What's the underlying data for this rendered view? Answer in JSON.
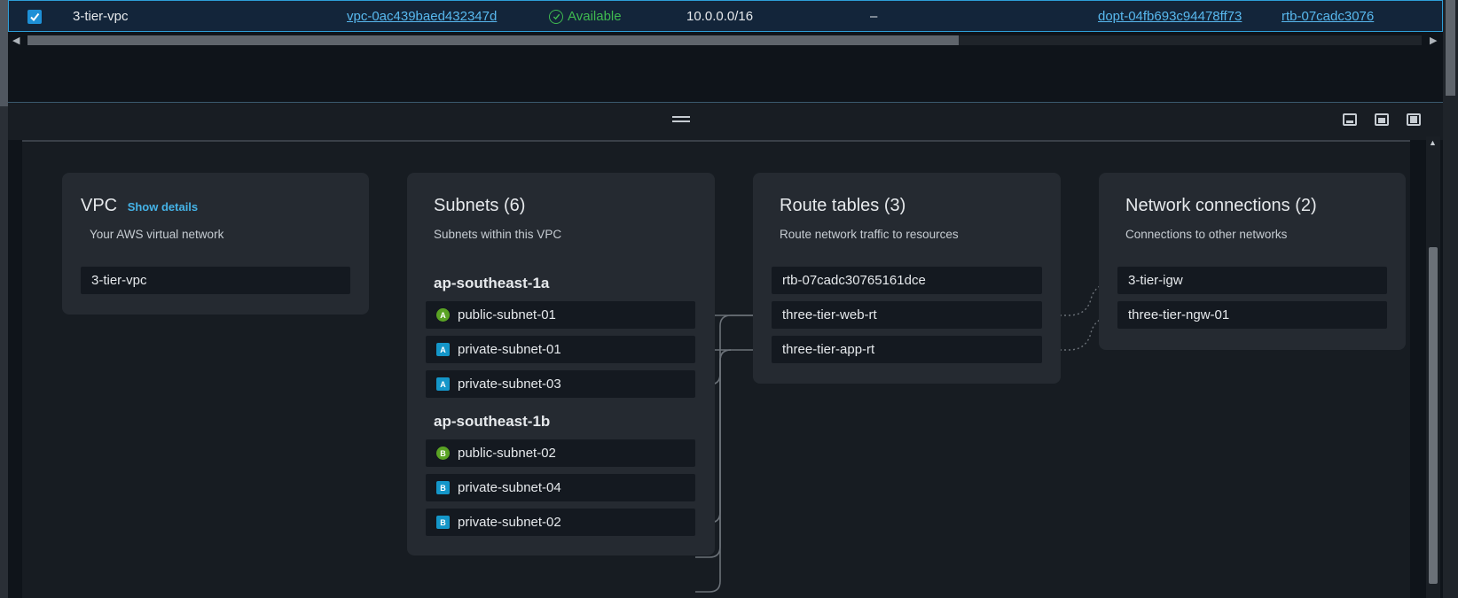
{
  "vpc_row": {
    "name": "3-tier-vpc",
    "vpc_id": "vpc-0ac439baed432347d",
    "state": "Available",
    "cidr": "10.0.0.0/16",
    "ipv6": "–",
    "dhcp_options": "dopt-04fb693c94478ff73",
    "route_table": "rtb-07cadc3076"
  },
  "map": {
    "vpc_card": {
      "title": "VPC",
      "show_details": "Show details",
      "subtitle": "Your AWS virtual network",
      "vpc_name": "3-tier-vpc"
    },
    "subnets_card": {
      "title": "Subnets (6)",
      "subtitle": "Subnets within this VPC",
      "zones": [
        {
          "name": "ap-southeast-1a",
          "subnets": [
            {
              "badge": "A",
              "type": "public",
              "name": "public-subnet-01"
            },
            {
              "badge": "A",
              "type": "private",
              "name": "private-subnet-01"
            },
            {
              "badge": "A",
              "type": "private",
              "name": "private-subnet-03"
            }
          ]
        },
        {
          "name": "ap-southeast-1b",
          "subnets": [
            {
              "badge": "B",
              "type": "public",
              "name": "public-subnet-02"
            },
            {
              "badge": "B",
              "type": "private",
              "name": "private-subnet-04"
            },
            {
              "badge": "B",
              "type": "private",
              "name": "private-subnet-02"
            }
          ]
        }
      ]
    },
    "route_tables_card": {
      "title": "Route tables (3)",
      "subtitle": "Route network traffic to resources",
      "items": [
        "rtb-07cadc30765161dce",
        "three-tier-web-rt",
        "three-tier-app-rt"
      ]
    },
    "network_card": {
      "title": "Network connections (2)",
      "subtitle": "Connections to other networks",
      "items": [
        "3-tier-igw",
        "three-tier-ngw-01"
      ]
    }
  },
  "colors": {
    "accent": "#58b8ee",
    "available": "#3fb950",
    "public_badge": "#5aa324",
    "private_badge": "#1496c9"
  }
}
